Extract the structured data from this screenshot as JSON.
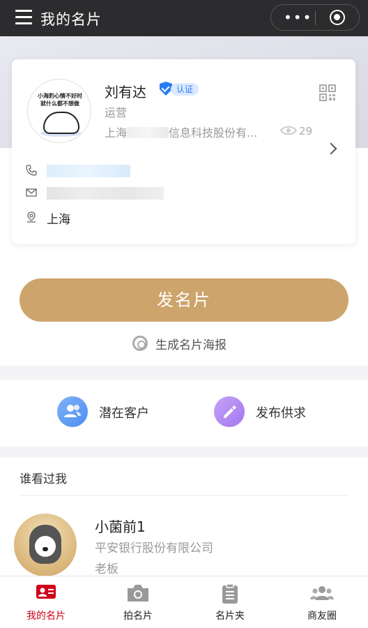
{
  "header": {
    "title": "我的名片"
  },
  "card": {
    "name": "刘有达",
    "verify_label": "认证",
    "role": "运营",
    "company_prefix": "上海",
    "company_suffix": "信息科技股份有...",
    "views": "29",
    "location": "上海",
    "avatar_caption": "小海豹心情不好时 就什么都不想做"
  },
  "actions": {
    "send_card": "发名片",
    "poster": "生成名片海报",
    "potential_customers": "潜在客户",
    "publish_demand": "发布供求"
  },
  "visitors": {
    "header": "谁看过我",
    "items": [
      {
        "name": "小菌前1",
        "company": "平安银行股份有限公司",
        "title": "老板"
      }
    ]
  },
  "tabs": [
    {
      "label": "我的名片",
      "active": true
    },
    {
      "label": "拍名片",
      "active": false
    },
    {
      "label": "名片夹",
      "active": false
    },
    {
      "label": "商友圈",
      "active": false
    }
  ],
  "colors": {
    "accent_gold": "#cda46c",
    "active_tab": "#d0021b",
    "verify_blue": "#2a7cf4"
  }
}
